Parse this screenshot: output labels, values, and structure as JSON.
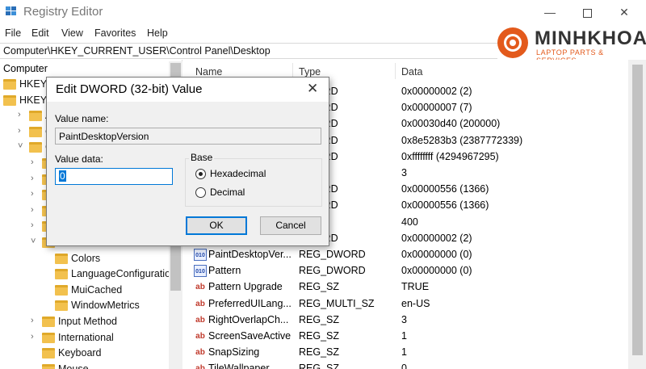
{
  "window": {
    "title": "Registry Editor"
  },
  "menu": [
    "File",
    "Edit",
    "View",
    "Favorites",
    "Help"
  ],
  "address": "Computer\\HKEY_CURRENT_USER\\Control Panel\\Desktop",
  "logo": {
    "name": "MINHKHOA",
    "tagline": "LAPTOP PARTS & SERVICES",
    "accent": "#e35a1c"
  },
  "tree": {
    "header": "Computer",
    "items": [
      {
        "label": "HKEY_",
        "indent": 0,
        "arrow": ""
      },
      {
        "label": "HKEY_",
        "indent": 0,
        "arrow": ""
      },
      {
        "label": "App",
        "indent": 1,
        "arrow": "›"
      },
      {
        "label": "Cor",
        "indent": 1,
        "arrow": "›"
      },
      {
        "label": "Cor",
        "indent": 1,
        "arrow": "˅"
      },
      {
        "label": "A",
        "indent": 2,
        "arrow": "›"
      },
      {
        "label": "A",
        "indent": 2,
        "arrow": "›"
      },
      {
        "label": "E",
        "indent": 2,
        "arrow": "›"
      },
      {
        "label": "C",
        "indent": 2,
        "arrow": "›"
      },
      {
        "label": "C",
        "indent": 2,
        "arrow": "›"
      },
      {
        "label": "",
        "indent": 2,
        "arrow": "˅"
      },
      {
        "label": "Colors",
        "indent": 3,
        "arrow": ""
      },
      {
        "label": "LanguageConfiguration",
        "indent": 3,
        "arrow": ""
      },
      {
        "label": "MuiCached",
        "indent": 3,
        "arrow": ""
      },
      {
        "label": "WindowMetrics",
        "indent": 3,
        "arrow": ""
      },
      {
        "label": "Input Method",
        "indent": 2,
        "arrow": "›"
      },
      {
        "label": "International",
        "indent": 2,
        "arrow": "›"
      },
      {
        "label": "Keyboard",
        "indent": 2,
        "arrow": ""
      },
      {
        "label": "Mouse",
        "indent": 2,
        "arrow": ""
      }
    ]
  },
  "list": {
    "columns": [
      "Name",
      "Type",
      "Data"
    ],
    "rows": [
      {
        "icon": "dword",
        "name": "",
        "type": "DWORD",
        "data": "0x00000002 (2)"
      },
      {
        "icon": "dword",
        "name": "",
        "type": "DWORD",
        "data": "0x00000007 (7)"
      },
      {
        "icon": "dword",
        "name": "",
        "type": "DWORD",
        "data": "0x00030d40 (200000)"
      },
      {
        "icon": "dword",
        "name": "",
        "type": "DWORD",
        "data": "0x8e5283b3 (2387772339)"
      },
      {
        "icon": "dword",
        "name": "",
        "type": "DWORD",
        "data": "0xffffffff (4294967295)"
      },
      {
        "icon": "sz",
        "name": "",
        "type": "Z",
        "data": "3"
      },
      {
        "icon": "dword",
        "name": "",
        "type": "DWORD",
        "data": "0x00000556 (1366)"
      },
      {
        "icon": "dword",
        "name": "",
        "type": "DWORD",
        "data": "0x00000556 (1366)"
      },
      {
        "icon": "sz",
        "name": "",
        "type": "Z",
        "data": "400"
      },
      {
        "icon": "dword",
        "name": "",
        "type": "DWORD",
        "data": "0x00000002 (2)"
      },
      {
        "icon": "dword",
        "name": "PaintDesktopVer...",
        "type": "REG_DWORD",
        "data": "0x00000000 (0)"
      },
      {
        "icon": "dword",
        "name": "Pattern",
        "type": "REG_DWORD",
        "data": "0x00000000 (0)"
      },
      {
        "icon": "sz",
        "name": "Pattern Upgrade",
        "type": "REG_SZ",
        "data": "TRUE"
      },
      {
        "icon": "sz",
        "name": "PreferredUILang...",
        "type": "REG_MULTI_SZ",
        "data": "en-US"
      },
      {
        "icon": "sz",
        "name": "RightOverlapCh...",
        "type": "REG_SZ",
        "data": "3"
      },
      {
        "icon": "sz",
        "name": "ScreenSaveActive",
        "type": "REG_SZ",
        "data": "1"
      },
      {
        "icon": "sz",
        "name": "SnapSizing",
        "type": "REG_SZ",
        "data": "1"
      },
      {
        "icon": "sz",
        "name": "TileWallpaper",
        "type": "REG_SZ",
        "data": "0"
      }
    ]
  },
  "dialog": {
    "title": "Edit DWORD (32-bit) Value",
    "value_name_label": "Value name:",
    "value_name": "PaintDesktopVersion",
    "value_data_label": "Value data:",
    "value_data": "0",
    "base_label": "Base",
    "hex_label": "Hexadecimal",
    "dec_label": "Decimal",
    "selected_base": "Hexadecimal",
    "ok_label": "OK",
    "cancel_label": "Cancel"
  }
}
